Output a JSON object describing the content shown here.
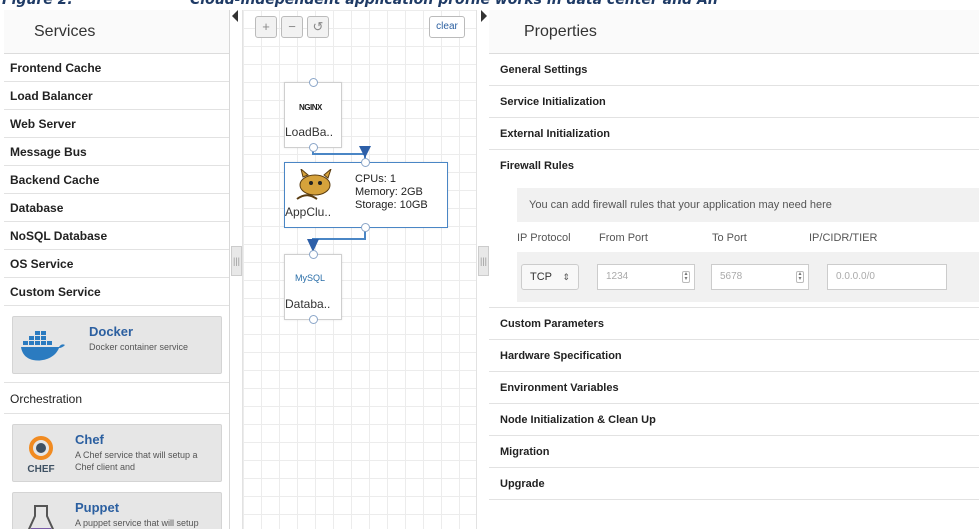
{
  "figure": {
    "number": "Figure 2.",
    "title": "Cloud-independent application profile works in data center and An"
  },
  "services": {
    "title": "Services",
    "items": [
      {
        "label": "Frontend Cache"
      },
      {
        "label": "Load Balancer"
      },
      {
        "label": "Web Server"
      },
      {
        "label": "Message Bus"
      },
      {
        "label": "Backend Cache"
      },
      {
        "label": "Database"
      },
      {
        "label": "NoSQL Database"
      },
      {
        "label": "OS Service"
      },
      {
        "label": "Custom Service"
      }
    ],
    "docker": {
      "title": "Docker",
      "desc": "Docker container service",
      "icon": "docker-icon"
    },
    "orchestration": {
      "title": "Orchestration",
      "cards": [
        {
          "title": "Chef",
          "desc": "A Chef service that will setup a Chef client and",
          "icon": "chef-icon",
          "logo_text": "CHEF"
        },
        {
          "title": "Puppet",
          "desc": "A puppet service that will setup Puppet agent and",
          "icon": "puppet-icon"
        }
      ]
    }
  },
  "canvas": {
    "toolbar": {
      "zoom_in": "+",
      "zoom_out": "−",
      "undo": "↺",
      "clear": "clear"
    },
    "nodes": {
      "loadbalancer": {
        "label": "LoadBa..",
        "logo_text": "NGINX",
        "icon": "nginx-icon"
      },
      "appcluster": {
        "label": "AppClu..",
        "icon": "tomcat-icon",
        "cpus": "CPUs: 1",
        "memory": "Memory: 2GB",
        "storage": "Storage: 10GB"
      },
      "database": {
        "label": "Databa..",
        "logo_text": "MySQL",
        "icon": "mysql-icon"
      }
    }
  },
  "properties": {
    "title": "Properties",
    "sections_top": [
      "General Settings",
      "Service Initialization",
      "External Initialization",
      "Firewall Rules"
    ],
    "firewall": {
      "hint": "You can add firewall rules that your application may need here",
      "headers": [
        "IP Protocol",
        "From Port",
        "To Port",
        "IP/CIDR/TIER"
      ],
      "protocol": "TCP",
      "from_port": "1234",
      "to_port": "5678",
      "cidr_placeholder": "0.0.0.0/0"
    },
    "sections_bottom": [
      "Custom Parameters",
      "Hardware Specification",
      "Environment Variables",
      "Node Initialization & Clean Up",
      "Migration",
      "Upgrade"
    ]
  },
  "colors": {
    "accent": "#2b5fa0",
    "arrow": "#2d5fa8",
    "node_border_selected": "#4a86c5"
  }
}
